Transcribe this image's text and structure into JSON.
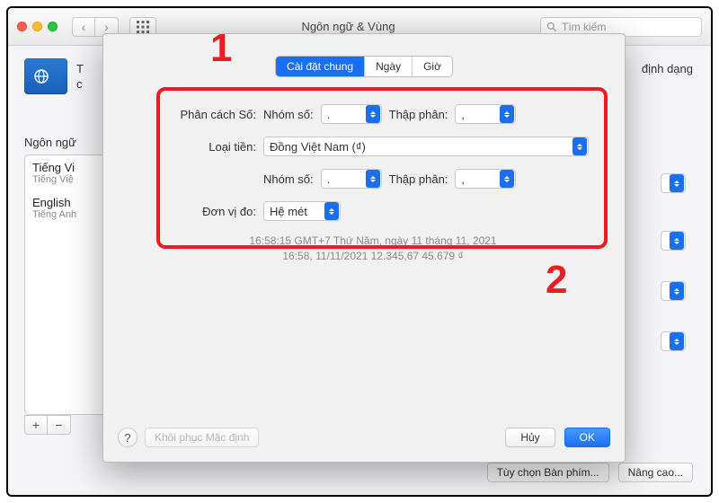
{
  "window": {
    "title": "Ngôn ngữ & Vùng",
    "search_placeholder": "Tìm kiếm"
  },
  "background": {
    "pref_line1": "T",
    "pref_line2": "c",
    "format_label": "định dạng",
    "lang_section_title": "Ngôn ngữ",
    "languages": [
      {
        "native": "Tiếng Vi",
        "english": "Tiếng Việ"
      },
      {
        "native": "English",
        "english": "Tiếng Anh"
      }
    ],
    "bottom_buttons": {
      "keyboard": "Tùy chọn Bàn phím...",
      "advanced": "Nâng cao..."
    }
  },
  "sheet": {
    "tabs": {
      "general": "Cài đặt chung",
      "dates": "Ngày",
      "times": "Giờ"
    },
    "labels": {
      "number_separators": "Phân cách Số:",
      "grouping": "Nhóm số:",
      "decimal": "Thập phân:",
      "currency": "Loại tiền:",
      "measurement": "Đơn vị đo:"
    },
    "values": {
      "grouping1": ".",
      "decimal1": ",",
      "currency": "Đồng Việt Nam (₫)",
      "grouping2": ".",
      "decimal2": ",",
      "measurement": "Hệ mét"
    },
    "examples": {
      "line1": "16:58:15 GMT+7 Thứ Năm, ngày 11 tháng 11, 2021",
      "line2": "16:58, 11/11/2021    12.345,67    45.679 ₫"
    },
    "restore_defaults": "Khôi phục Mặc định",
    "cancel": "Hủy",
    "ok": "OK"
  },
  "annotations": {
    "n1": "1",
    "n2": "2"
  },
  "colors": {
    "accent": "#1a6ff1",
    "annotation": "#ec1c24"
  }
}
